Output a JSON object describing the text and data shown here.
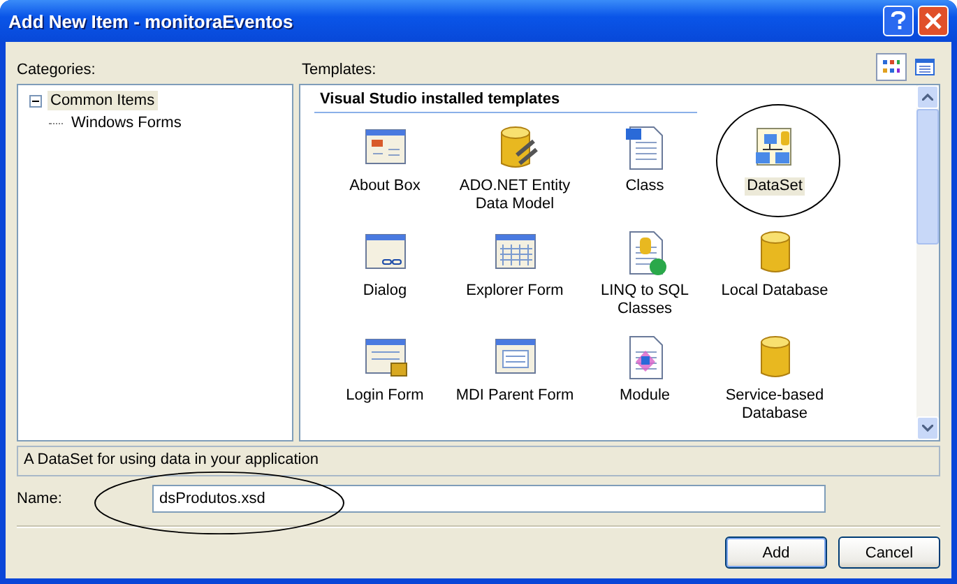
{
  "window": {
    "title": "Add New Item - monitoraEventos"
  },
  "view_buttons": [
    {
      "selected": true
    },
    {
      "selected": false
    }
  ],
  "categories": {
    "label": "Categories:",
    "items": [
      {
        "label": "Common Items",
        "selected": true,
        "expanded": true,
        "children": [
          {
            "label": "Windows Forms",
            "selected": false
          }
        ]
      }
    ]
  },
  "templates": {
    "label": "Templates:",
    "group": "Visual Studio installed templates",
    "items": [
      {
        "label": "About Box",
        "selected": false
      },
      {
        "label": "ADO.NET Entity Data Model",
        "selected": false
      },
      {
        "label": "Class",
        "selected": false
      },
      {
        "label": "DataSet",
        "selected": true
      },
      {
        "label": "Dialog",
        "selected": false
      },
      {
        "label": "Explorer Form",
        "selected": false
      },
      {
        "label": "LINQ to SQL Classes",
        "selected": false
      },
      {
        "label": "Local Database",
        "selected": false
      },
      {
        "label": "Login Form",
        "selected": false
      },
      {
        "label": "MDI Parent Form",
        "selected": false
      },
      {
        "label": "Module",
        "selected": false
      },
      {
        "label": "Service-based Database",
        "selected": false
      }
    ]
  },
  "description": "A DataSet for using data in your application",
  "name_field": {
    "label": "Name:",
    "value": "dsProdutos.xsd"
  },
  "buttons": [
    "Add",
    "Cancel"
  ]
}
